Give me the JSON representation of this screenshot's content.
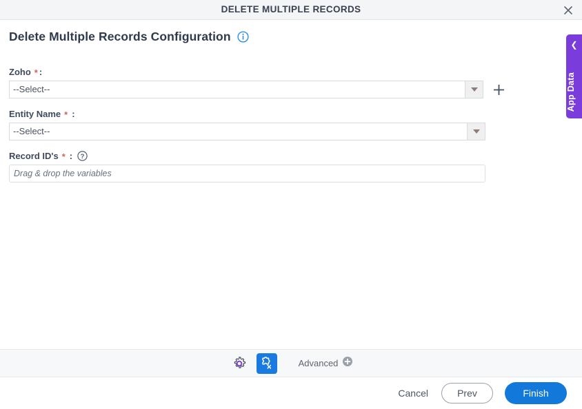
{
  "window": {
    "title": "DELETE MULTIPLE RECORDS",
    "close_icon": "close-icon"
  },
  "heading": {
    "title": "Delete Multiple Records Configuration",
    "info_icon": "info-icon"
  },
  "form": {
    "fields": [
      {
        "label": "Zoho",
        "required_mark": "*",
        "colon": ":",
        "colon_spaced": false,
        "type": "select",
        "value": "--Select--",
        "has_add_button": true,
        "add_icon": "plus-icon",
        "arrow_icon": "caret-down-icon"
      },
      {
        "label": "Entity Name",
        "required_mark": "*",
        "colon": ":",
        "colon_spaced": true,
        "type": "select",
        "value": "--Select--",
        "has_add_button": false,
        "arrow_icon": "caret-down-icon"
      },
      {
        "label": "Record ID's",
        "required_mark": "*",
        "colon": ":",
        "colon_spaced": true,
        "type": "text",
        "value": "",
        "placeholder": "Drag & drop the variables",
        "help_icon": "help-circle-icon"
      }
    ]
  },
  "app_data_tab": {
    "label": "App Data",
    "chevron_icon": "chevron-left-icon",
    "color": "#7a3ddb"
  },
  "toolbar": {
    "settings_icon": "gear-icon",
    "plugin_icon": "puzzle-x-icon",
    "plugin_active_color": "#1a7ae0",
    "advanced_label": "Advanced",
    "advanced_add_icon": "plus-circle-icon"
  },
  "footer": {
    "cancel_label": "Cancel",
    "prev_label": "Prev",
    "finish_label": "Finish",
    "finish_color": "#1279db"
  }
}
